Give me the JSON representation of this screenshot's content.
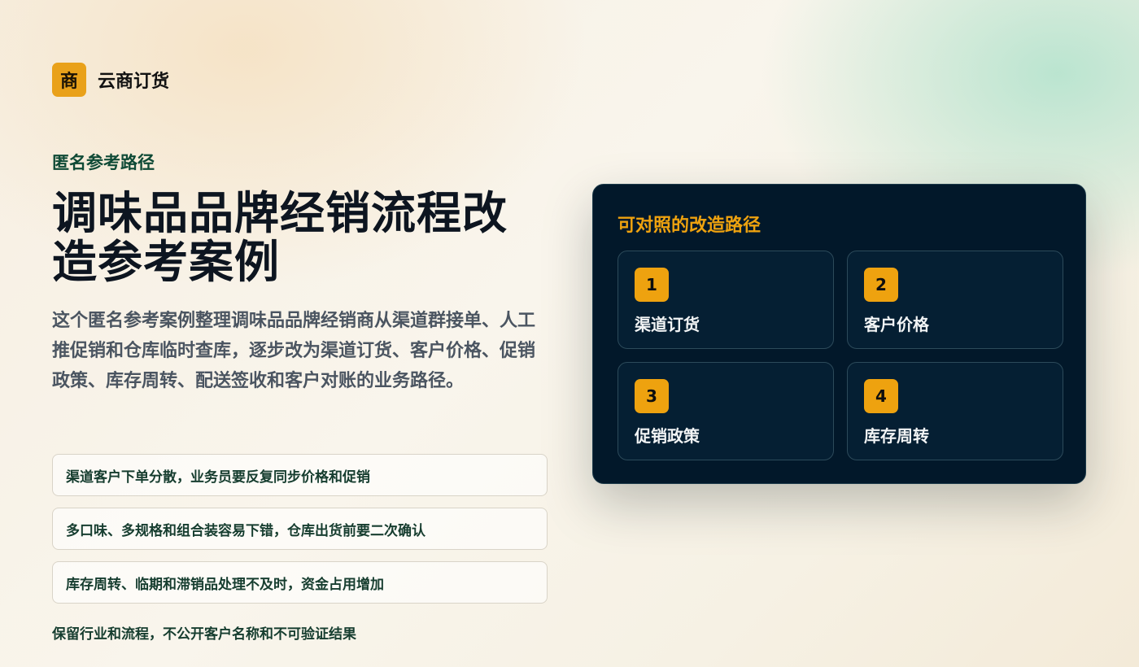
{
  "brand": {
    "mark": "商",
    "name": "云商订货"
  },
  "hero": {
    "eyebrow": "匿名参考路径",
    "title": "调味品品牌经销流程改造参考案例",
    "lede": "这个匿名参考案例整理调味品品牌经销商从渠道群接单、人工推促销和仓库临时查库，逐步改为渠道订货、客户价格、促销政策、库存周转、配送签收和客户对账的业务路径。"
  },
  "pains": [
    "渠道客户下单分散，业务员要反复同步价格和促销",
    "多口味、多规格和组合装容易下错，仓库出货前要二次确认",
    "库存周转、临期和滞销品处理不及时，资金占用增加"
  ],
  "note": "保留行业和流程，不公开客户名称和不可验证结果",
  "path_card": {
    "title": "可对照的改造路径",
    "steps": [
      {
        "num": "1",
        "label": "渠道订货"
      },
      {
        "num": "2",
        "label": "客户价格"
      },
      {
        "num": "3",
        "label": "促销政策"
      },
      {
        "num": "4",
        "label": "库存周转"
      }
    ]
  },
  "colors": {
    "accent": "#eea20f",
    "card_bg": "#02182a",
    "green_text": "#0f4a36"
  }
}
